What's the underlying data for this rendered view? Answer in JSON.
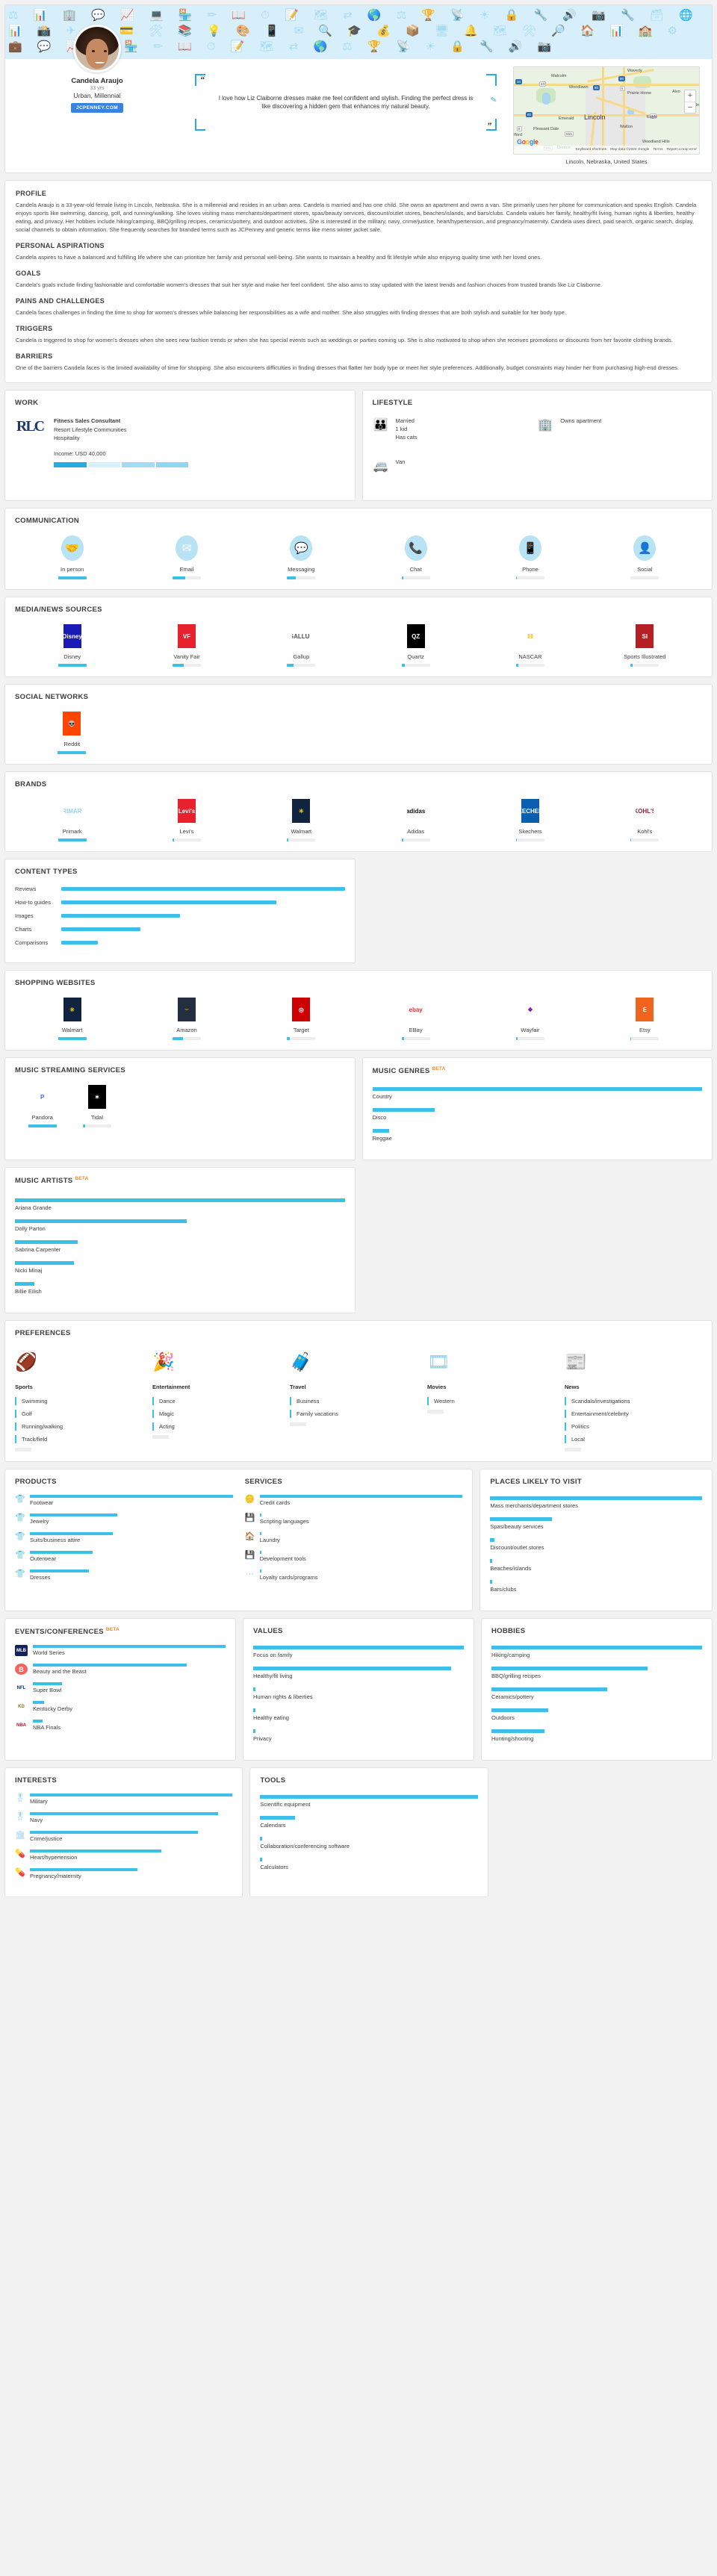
{
  "person": {
    "name": "Candela Araujo",
    "age": "33 yrs",
    "segment": "Urban, Millennial",
    "site": "JCPENNEY.COM",
    "quote": "I love how Liz Claiborne dresses make me feel confident and stylish. Finding the perfect dress is like discovering a hidden gem that enhances my natural beauty.",
    "location": "Lincoln, Nebraska, United States"
  },
  "map": {
    "center_label": "Lincoln",
    "labels": [
      "Malcolm",
      "Woodlawn",
      "Waverly",
      "Prairie Home",
      "Alvo",
      "Emerald",
      "Eagle",
      "Walton",
      "Pleasant Dale",
      "Denton",
      "Woodland Hills",
      "Iford"
    ],
    "shields": [
      "34",
      "34",
      "80",
      "80",
      "6",
      "6",
      "34",
      "55A",
      "103"
    ],
    "attribution": [
      "Keyboard shortcuts",
      "Map data ©2024 Google",
      "Terms",
      "Report a map error"
    ],
    "google": "Google",
    "zoom_in": "+",
    "zoom_out": "−"
  },
  "narrative": [
    {
      "heading": "PROFILE",
      "body": "Candela Araujo is a 33-year-old female living in Lincoln, Nebraska. She is a millennial and resides in an urban area. Candela is married and has one child. She owns an apartment and owns a van. She primarily uses her phone for communication and speaks English. Candela enjoys sports like swimming, dancing, golf, and running/walking. She loves visiting mass merchants/department stores, spas/beauty services, discount/outlet stores, beaches/islands, and bars/clubs. Candela values her family, healthy/fit living, human rights & liberties, healthy eating, and privacy. Her hobbies include hiking/camping, BBQ/grilling recipes, ceramics/pottery, and outdoor activities. She is interested in the military, navy, crime/justice, heart/hypertension, and pregnancy/maternity. Candela uses direct, paid search, organic search, display, social channels to obtain information. She frequently searches for branded terms such as JCPenney and generic terms like mens winter jacket sale."
    },
    {
      "heading": "PERSONAL ASPIRATIONS",
      "body": "Candela aspires to have a balanced and fulfilling life where she can prioritize her family and personal well-being. She wants to maintain a healthy and fit lifestyle while also enjoying quality time with her loved ones."
    },
    {
      "heading": "GOALS",
      "body": "Candela's goals include finding fashionable and comfortable women's dresses that suit her style and make her feel confident. She also aims to stay updated with the latest trends and fashion choices from trusted brands like Liz Claiborne."
    },
    {
      "heading": "PAINS AND CHALLENGES",
      "body": "Candela faces challenges in finding the time to shop for women's dresses while balancing her responsibilities as a wife and mother. She also struggles with finding dresses that are both stylish and suitable for her body type."
    },
    {
      "heading": "TRIGGERS",
      "body": "Candela is triggered to shop for women's dresses when she sees new fashion trends or when she has special events such as weddings or parties coming up. She is also motivated to shop when she receives promotions or discounts from her favorite clothing brands."
    },
    {
      "heading": "BARRIERS",
      "body": "One of the barriers Candela faces is the limited availability of time for shopping. She also encounters difficulties in finding dresses that flatter her body type or meet her style preferences. Additionally, budget constraints may hinder her from purchasing high-end dresses."
    }
  ],
  "work": {
    "title": "WORK",
    "logo_text": "RLC",
    "job_title": "Fitness Sales Consultant",
    "company": "Resort Lifestyle Communities",
    "industry": "Hospitality",
    "income": "Income: USD 40,000",
    "income_segments": [
      {
        "color": "#29abe2"
      },
      {
        "color": "#d8f0fa"
      },
      {
        "color": "#9fddf3"
      },
      {
        "color": "#8fd6f1"
      }
    ]
  },
  "lifestyle": {
    "title": "LIFESTYLE",
    "items": [
      {
        "icon": "family-icon",
        "glyph": "👪",
        "lines": [
          "Married",
          "1 kid",
          "Has cats"
        ]
      },
      {
        "icon": "apartment-icon",
        "glyph": "🏢",
        "lines": [
          "Owns apartment"
        ]
      },
      {
        "icon": "van-icon",
        "glyph": "🚐",
        "lines": [
          "Van"
        ]
      }
    ]
  },
  "communication": {
    "title": "COMMUNICATION",
    "items": [
      {
        "label": "In person",
        "icon": "handshake-icon",
        "glyph": "🤝",
        "pct": 100
      },
      {
        "label": "Email",
        "icon": "envelope-icon",
        "glyph": "✉",
        "pct": 45
      },
      {
        "label": "Messaging",
        "icon": "speech-bubble-icon",
        "glyph": "💬",
        "pct": 30
      },
      {
        "label": "Chat",
        "icon": "phone-ring-icon",
        "glyph": "📞",
        "pct": 5
      },
      {
        "label": "Phone",
        "icon": "smartphone-icon",
        "glyph": "📱",
        "pct": 3
      },
      {
        "label": "Social",
        "icon": "person-icon",
        "glyph": "👤",
        "pct": 0
      }
    ]
  },
  "media": {
    "title": "MEDIA/NEWS SOURCES",
    "items": [
      {
        "label": "Disney",
        "logo_text": "Disney",
        "bg": "#1a1ab4",
        "fg": "#ffffff",
        "pct": 100
      },
      {
        "label": "Vanity Fair",
        "logo_text": "VF",
        "bg": "#e8212e",
        "fg": "#ffffff",
        "pct": 40
      },
      {
        "label": "Gallup",
        "logo_text": "GALLUP",
        "bg": "#ffffff",
        "fg": "#555555",
        "pct": 22
      },
      {
        "label": "Quartz",
        "logo_text": "QZ",
        "bg": "#000000",
        "fg": "#ffffff",
        "pct": 12
      },
      {
        "label": "NASCAR",
        "logo_text": "‖‖",
        "bg": "#ffffff",
        "fg": "#f2b705",
        "pct": 8
      },
      {
        "label": "Sports Illustrated",
        "logo_text": "SI",
        "bg": "#b62025",
        "fg": "#ffffff",
        "pct": 6
      }
    ]
  },
  "social_networks": {
    "title": "SOCIAL NETWORKS",
    "items": [
      {
        "label": "Reddit",
        "logo_text": "👽",
        "bg": "#ff4500",
        "fg": "#ffffff",
        "pct": 100
      }
    ]
  },
  "brands": {
    "title": "BRANDS",
    "items": [
      {
        "label": "Primark",
        "logo_text": "PRIMARK",
        "bg": "#ffffff",
        "fg": "#8fd6f1",
        "pct": 100
      },
      {
        "label": "Levi's",
        "logo_text": "Levi's",
        "bg": "#e8212e",
        "fg": "#ffffff",
        "pct": 5
      },
      {
        "label": "Walmart",
        "logo_text": "✳",
        "bg": "#10243f",
        "fg": "#f5c518",
        "pct": 5
      },
      {
        "label": "Adidas",
        "logo_text": "adidas",
        "bg": "#ffffff",
        "fg": "#111111",
        "pct": 5
      },
      {
        "label": "Skechers",
        "logo_text": "SKECHERS",
        "bg": "#0a5eb0",
        "fg": "#ffffff",
        "pct": 4
      },
      {
        "label": "Kohl's",
        "logo_text": "KOHL'S",
        "bg": "#ffffff",
        "fg": "#8e1b3a",
        "pct": 3
      }
    ]
  },
  "content_types": {
    "title": "CONTENT TYPES",
    "items": [
      {
        "label": "Reviews",
        "pct": 100
      },
      {
        "label": "How-to guides",
        "pct": 76
      },
      {
        "label": "Images",
        "pct": 42
      },
      {
        "label": "Charts",
        "pct": 28
      },
      {
        "label": "Comparisons",
        "pct": 13
      }
    ]
  },
  "shopping_websites": {
    "title": "SHOPPING WEBSITES",
    "items": [
      {
        "label": "Walmart",
        "logo_text": "✳",
        "bg": "#10243f",
        "fg": "#f5c518",
        "pct": 100
      },
      {
        "label": "Amazon",
        "logo_text": "⌣",
        "bg": "#232f3e",
        "fg": "#ff9900",
        "pct": 38
      },
      {
        "label": "Target",
        "logo_text": "◎",
        "bg": "#cc0000",
        "fg": "#ffffff",
        "pct": 10
      },
      {
        "label": "EBay",
        "logo_text": "ebay",
        "bg": "#ffffff",
        "fg": "#e53238",
        "pct": 8
      },
      {
        "label": "Wayfair",
        "logo_text": "❖",
        "bg": "#ffffff",
        "fg": "#7b189f",
        "pct": 5
      },
      {
        "label": "Etsy",
        "logo_text": "E",
        "bg": "#f1641e",
        "fg": "#ffffff",
        "pct": 3
      }
    ]
  },
  "music_streaming": {
    "title": "MUSIC STREAMING SERVICES",
    "items": [
      {
        "label": "Pandora",
        "logo_text": "P",
        "bg": "#ffffff",
        "fg": "#3668ff",
        "pct": 100
      },
      {
        "label": "Tidal",
        "logo_text": "✶",
        "bg": "#000000",
        "fg": "#ffffff",
        "pct": 8
      }
    ]
  },
  "music_genres": {
    "title": "MUSIC GENRES",
    "beta": "BETA",
    "items": [
      {
        "label": "Country",
        "pct": 100
      },
      {
        "label": "Disco",
        "pct": 19
      },
      {
        "label": "Reggae",
        "pct": 5
      }
    ]
  },
  "music_artists": {
    "title": "MUSIC ARTISTS",
    "beta": "BETA",
    "items": [
      {
        "label": "Ariana Grande",
        "pct": 100
      },
      {
        "label": "Dolly Parton",
        "pct": 52
      },
      {
        "label": "Sabrina Carpenter",
        "pct": 19
      },
      {
        "label": "Nicki Minaj",
        "pct": 18
      },
      {
        "label": "Billie Eilish",
        "pct": 6
      }
    ]
  },
  "preferences": {
    "title": "PREFERENCES",
    "columns": [
      {
        "heading": "Sports",
        "icon": "football-icon",
        "glyph": "🏈",
        "items": [
          "Swimming",
          "Golf",
          "Running/walking",
          "Track/field"
        ],
        "ghost": true
      },
      {
        "heading": "Entertainment",
        "icon": "party-popper-icon",
        "glyph": "🎉",
        "items": [
          "Dance",
          "Magic",
          "Acting"
        ],
        "ghost": true
      },
      {
        "heading": "Travel",
        "icon": "luggage-icon",
        "glyph": "🧳",
        "items": [
          "Business",
          "Family vacations"
        ],
        "ghost": true
      },
      {
        "heading": "Movies",
        "icon": "film-icon",
        "glyph": "🎞",
        "items": [
          "Western"
        ],
        "ghost": true
      },
      {
        "heading": "News",
        "icon": "newspaper-icon",
        "glyph": "📰",
        "items": [
          "Scandals/investigations",
          "Entertainment/celebrity",
          "Politics",
          "Local"
        ],
        "ghost": true
      }
    ]
  },
  "products": {
    "title": "PRODUCTS",
    "items": [
      {
        "label": "Footwear",
        "icon": "shirt-icon",
        "glyph": "👕",
        "pct": 100
      },
      {
        "label": "Jewelry",
        "icon": "shirt-icon",
        "glyph": "👕",
        "pct": 43
      },
      {
        "label": "Suits/business attire",
        "icon": "shirt-icon",
        "glyph": "👕",
        "pct": 41
      },
      {
        "label": "Outerwear",
        "icon": "shirt-icon",
        "glyph": "👕",
        "pct": 31
      },
      {
        "label": "Dresses",
        "icon": "shirt-icon",
        "glyph": "👕",
        "pct": 29
      }
    ]
  },
  "services": {
    "title": "SERVICES",
    "items": [
      {
        "label": "Credit cards",
        "icon": "coins-icon",
        "glyph": "🪙",
        "pct": 100
      },
      {
        "label": "Scripting languages",
        "icon": "chip-icon",
        "glyph": "💾",
        "pct": 1
      },
      {
        "label": "Laundry",
        "icon": "house-icon",
        "glyph": "🏠",
        "pct": 1
      },
      {
        "label": "Development tools",
        "icon": "chip-icon",
        "glyph": "💾",
        "pct": 1
      },
      {
        "label": "Loyalty cards/programs",
        "icon": "dots-icon",
        "glyph": "⋯",
        "pct": 1
      }
    ]
  },
  "places": {
    "title": "PLACES LIKELY TO VISIT",
    "items": [
      {
        "label": "Mass merchants/department stores",
        "pct": 100
      },
      {
        "label": "Spas/beauty services",
        "pct": 29
      },
      {
        "label": "Discount/outlet stores",
        "pct": 2
      },
      {
        "label": "Beaches/islands",
        "pct": 1
      },
      {
        "label": "Bars/clubs",
        "pct": 1
      }
    ]
  },
  "events": {
    "title": "EVENTS/CONFERENCES",
    "beta": "BETA",
    "items": [
      {
        "label": "World Series",
        "icon": "mlb-icon",
        "logo_text": "MLB",
        "bg": "#14225b",
        "fg": "#ffffff",
        "pct": 100
      },
      {
        "label": "Beauty and the Beast",
        "icon": "beauty-beast-icon",
        "logo_text": "B",
        "bg": "#f9615f",
        "fg": "#ffffff",
        "pct": 80
      },
      {
        "label": "Super Bowl",
        "icon": "nfl-icon",
        "logo_text": "NFL",
        "bg": "#ffffff",
        "fg": "#013369",
        "pct": 15
      },
      {
        "label": "Kentucky Derby",
        "icon": "kentucky-derby-icon",
        "logo_text": "KD",
        "bg": "#ffffff",
        "fg": "#8a6d1f",
        "pct": 6
      },
      {
        "label": "NBA Finals",
        "icon": "nba-icon",
        "logo_text": "NBA",
        "bg": "#ffffff",
        "fg": "#c8102e",
        "pct": 5
      }
    ]
  },
  "values": {
    "title": "VALUES",
    "items": [
      {
        "label": "Focus on family",
        "pct": 100
      },
      {
        "label": "Healthy/fit living",
        "pct": 94
      },
      {
        "label": "Human rights & liberties",
        "pct": 1
      },
      {
        "label": "Healthy eating",
        "pct": 1
      },
      {
        "label": "Privacy",
        "pct": 1
      }
    ]
  },
  "hobbies": {
    "title": "HOBBIES",
    "items": [
      {
        "label": "Hiking/camping",
        "pct": 100
      },
      {
        "label": "BBQ/grilling recipes",
        "pct": 74
      },
      {
        "label": "Ceramics/pottery",
        "pct": 55
      },
      {
        "label": "Outdoors",
        "pct": 27
      },
      {
        "label": "Hunting/shooting",
        "pct": 25
      }
    ]
  },
  "interests": {
    "title": "INTERESTS",
    "items": [
      {
        "label": "Military",
        "icon": "dogtag-icon",
        "glyph": "🎖",
        "pct": 100
      },
      {
        "label": "Navy",
        "icon": "dogtag-icon",
        "glyph": "🎖",
        "pct": 93
      },
      {
        "label": "Crime/justice",
        "icon": "courthouse-icon",
        "glyph": "🏛",
        "pct": 83
      },
      {
        "label": "Heart/hypertension",
        "icon": "medical-icon",
        "glyph": "💊",
        "pct": 65
      },
      {
        "label": "Pregnancy/maternity",
        "icon": "medical-icon",
        "glyph": "💊",
        "pct": 53
      }
    ]
  },
  "tools": {
    "title": "TOOLS",
    "items": [
      {
        "label": "Scientific equipment",
        "pct": 100
      },
      {
        "label": "Calendars",
        "pct": 16
      },
      {
        "label": "Collaboration/conferencing software",
        "pct": 1
      },
      {
        "label": "Calculators",
        "pct": 1
      }
    ]
  }
}
